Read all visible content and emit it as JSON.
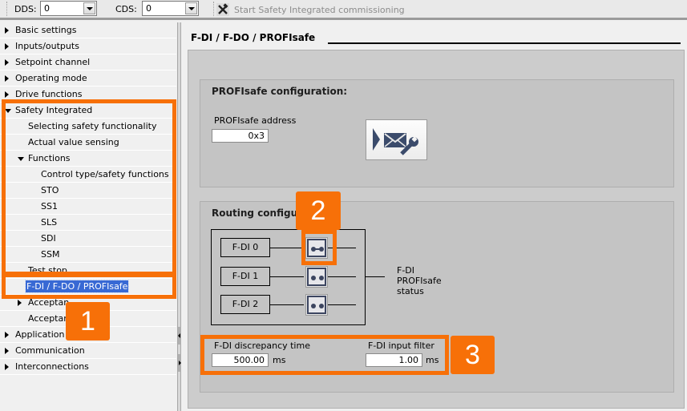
{
  "toolbar": {
    "dds_label": "DDS:",
    "dds_value": "0",
    "cds_label": "CDS:",
    "cds_value": "0",
    "commissioning_label": "Start Safety Integrated commissioning",
    "commissioning_icon": "tools-icon"
  },
  "sidebar": {
    "items": [
      {
        "label": "Basic settings",
        "level": 0,
        "expander": "collapsed"
      },
      {
        "label": "Inputs/outputs",
        "level": 0,
        "expander": "collapsed"
      },
      {
        "label": "Setpoint channel",
        "level": 0,
        "expander": "collapsed"
      },
      {
        "label": "Operating mode",
        "level": 0,
        "expander": "collapsed"
      },
      {
        "label": "Drive functions",
        "level": 0,
        "expander": "collapsed"
      },
      {
        "label": "Safety Integrated",
        "level": 0,
        "expander": "expanded"
      },
      {
        "label": "Selecting safety functionality",
        "level": 1,
        "expander": "none"
      },
      {
        "label": "Actual value sensing",
        "level": 1,
        "expander": "none"
      },
      {
        "label": "Functions",
        "level": 1,
        "expander": "expanded"
      },
      {
        "label": "Control type/safety functions",
        "level": 2,
        "expander": "none"
      },
      {
        "label": "STO",
        "level": 2,
        "expander": "none"
      },
      {
        "label": "SS1",
        "level": 2,
        "expander": "none"
      },
      {
        "label": "SLS",
        "level": 2,
        "expander": "none"
      },
      {
        "label": "SDI",
        "level": 2,
        "expander": "none"
      },
      {
        "label": "SSM",
        "level": 2,
        "expander": "none"
      },
      {
        "label": "Test stop",
        "level": 1,
        "expander": "none"
      },
      {
        "label": "F-DI / F-DO / PROFIsafe",
        "level": 1,
        "expander": "none",
        "selected": true
      },
      {
        "label": "Acceptan",
        "level": 1,
        "expander": "collapsed"
      },
      {
        "label": "Acceptan",
        "level": 1,
        "expander": "none"
      },
      {
        "label": "Application",
        "level": 0,
        "expander": "collapsed"
      },
      {
        "label": "Communication",
        "level": 0,
        "expander": "collapsed"
      },
      {
        "label": "Interconnections",
        "level": 0,
        "expander": "collapsed"
      }
    ]
  },
  "main": {
    "title": "F-DI / F-DO / PROFIsafe",
    "profisafe": {
      "heading": "PROFIsafe configuration:",
      "address_label": "PROFIsafe address",
      "address_value": "0x3",
      "config_button_icon": "telegram-configuration-icon"
    },
    "routing": {
      "heading": "Routing configuration",
      "heading_visible": "Routing configu",
      "inputs": [
        "F-DI 0",
        "F-DI 1",
        "F-DI 2"
      ],
      "switch_states": [
        "closed",
        "open",
        "open"
      ],
      "status_label_lines": [
        "F-DI",
        "PROFIsafe",
        "status"
      ]
    },
    "discrepancy": {
      "label": "F-DI discrepancy time",
      "value": "500.00",
      "unit": "ms"
    },
    "input_filter": {
      "label": "F-DI input filter",
      "value": "1.00",
      "unit": "ms"
    }
  },
  "annotations": {
    "color": "#f77008",
    "badges": [
      "1",
      "2",
      "3"
    ]
  }
}
